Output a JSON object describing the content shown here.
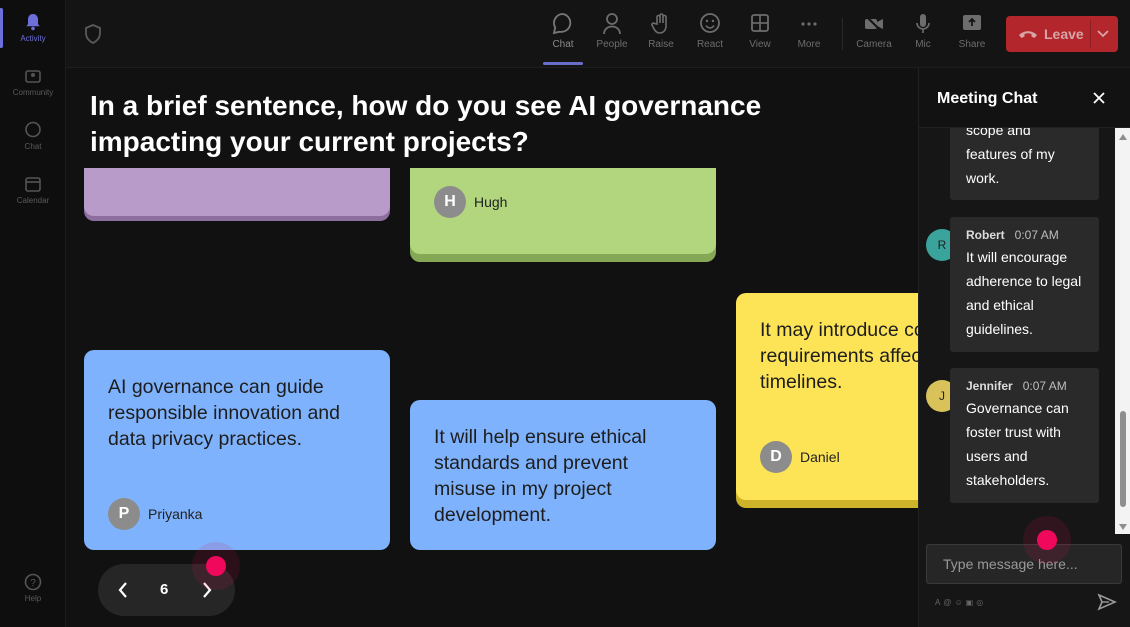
{
  "rail": {
    "items": [
      {
        "label": "Activity",
        "icon": "bell-icon"
      },
      {
        "label": "Community",
        "icon": "community-icon"
      },
      {
        "label": "Chat",
        "icon": "chat-icon"
      },
      {
        "label": "Calendar",
        "icon": "calendar-icon"
      },
      {
        "label": "Help",
        "icon": "help-icon"
      }
    ]
  },
  "toolbar": {
    "chat": "Chat",
    "people": "People",
    "raise": "Raise",
    "react": "React",
    "view": "View",
    "more": "More",
    "camera": "Camera",
    "mic": "Mic",
    "share": "Share",
    "leave": "Leave"
  },
  "stage": {
    "question": "In a brief sentence, how do you see AI governance impacting your current projects?",
    "cards": [
      {
        "author": "Hugh",
        "initial": "H"
      },
      {
        "text": "AI governance can guide responsible innovation and data privacy practices.",
        "author": "Priyanka",
        "initial": "P"
      },
      {
        "text": "It will help ensure ethical standards and prevent misuse in my project development."
      },
      {
        "text": "It may introduce compliance requirements affecting project timelines.",
        "author": "Daniel",
        "initial": "D"
      }
    ],
    "page": "6"
  },
  "chat": {
    "title": "Meeting Chat",
    "messages": [
      {
        "text": "scope and features of my work."
      },
      {
        "name": "Robert",
        "time": "0:07 AM",
        "initial": "R",
        "avatar_color": "#3aa39b",
        "text": "It will encourage adherence to legal and ethical guidelines."
      },
      {
        "name": "Jennifer",
        "time": "0:07 AM",
        "initial": "J",
        "avatar_color": "#d9c25a",
        "text": "Governance can foster trust with users and stakeholders."
      }
    ],
    "input_placeholder": "Type message here..."
  },
  "colors": {
    "accent": "#6c6fd9",
    "leave": "#b3262b",
    "card_blue": "#7fb2fc",
    "card_green": "#b1d67e",
    "card_yellow": "#fde457",
    "card_purple": "#b99bc9",
    "cursor": "#f0085c"
  }
}
